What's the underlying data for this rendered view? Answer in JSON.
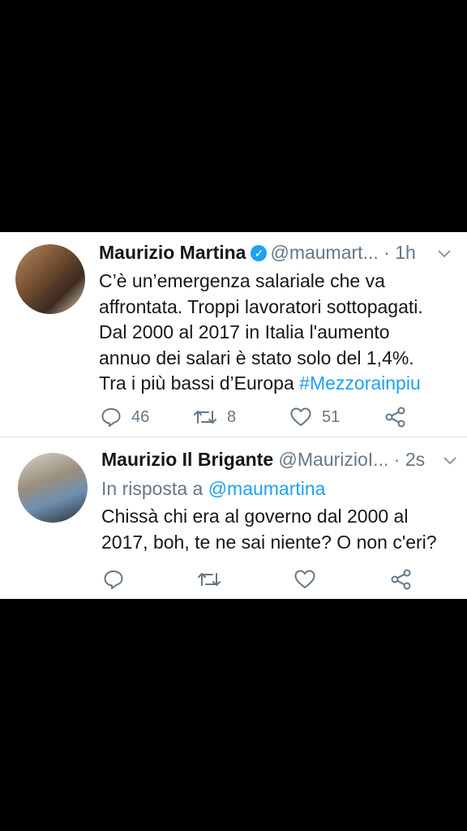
{
  "tweets": [
    {
      "name": "Maurizio Martina",
      "handle": "@maumart...",
      "separator": " · ",
      "time": "1h",
      "verified": true,
      "text_lines": [
        "C’è un’emergenza salariale che va",
        "affrontata. Troppi lavoratori sottopagati.",
        "Dal 2000 al 2017 in Italia l'aumento",
        "annuo dei salari è stato solo del 1,4%.",
        "Tra i più bassi d’Europa "
      ],
      "hashtag": "#Mezzorainpiu",
      "replies": "46",
      "retweets": "8",
      "likes": "51"
    },
    {
      "name": "Maurizio Il Brigante",
      "handle": "@MaurizioI...",
      "separator": " · ",
      "time": "2s",
      "reply_prefix": "In risposta a ",
      "reply_handle": "@maumartina",
      "text_lines": [
        "Chissà chi era al governo dal 2000 al",
        "2017, boh, te ne sai niente? O non c'eri?"
      ]
    }
  ],
  "icons": {
    "reply": "reply-icon",
    "retweet": "retweet-icon",
    "like": "heart-icon",
    "share": "share-icon",
    "menu": "chevron-down-icon",
    "verified": "verified-badge-icon"
  },
  "colors": {
    "link": "#1da1f2",
    "secondary": "#657786",
    "text": "#14171a"
  }
}
